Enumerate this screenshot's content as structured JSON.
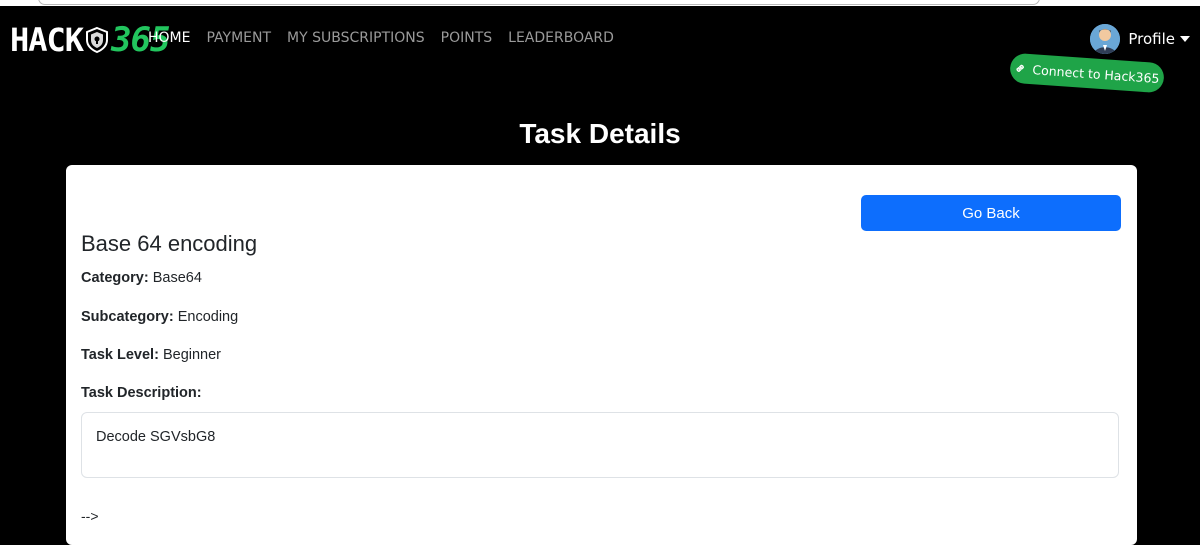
{
  "brand": {
    "logo_text": "HACK",
    "logo_number": "365",
    "accent_color": "#22c55e"
  },
  "nav": {
    "items": [
      {
        "label": "HOME",
        "active": true
      },
      {
        "label": "PAYMENT",
        "active": false
      },
      {
        "label": "MY SUBSCRIPTIONS",
        "active": false
      },
      {
        "label": "POINTS",
        "active": false
      },
      {
        "label": "LEADERBOARD",
        "active": false
      }
    ]
  },
  "profile": {
    "label": "Profile",
    "icon": "chevron-down-icon"
  },
  "connect": {
    "label": "Connect to Hack365",
    "icon": "link-icon",
    "color": "#1fa448"
  },
  "page": {
    "title": "Task Details"
  },
  "task": {
    "go_back_label": "Go Back",
    "go_back_color": "#0d6efd",
    "name": "Base 64 encoding",
    "category_label": "Category:",
    "category_value": "Base64",
    "subcategory_label": "Subcategory:",
    "subcategory_value": "Encoding",
    "level_label": "Task Level:",
    "level_value": "Beginner",
    "description_label": "Task Description:",
    "description_value": "Decode SGVsbG8",
    "trailing_text": "-->"
  }
}
